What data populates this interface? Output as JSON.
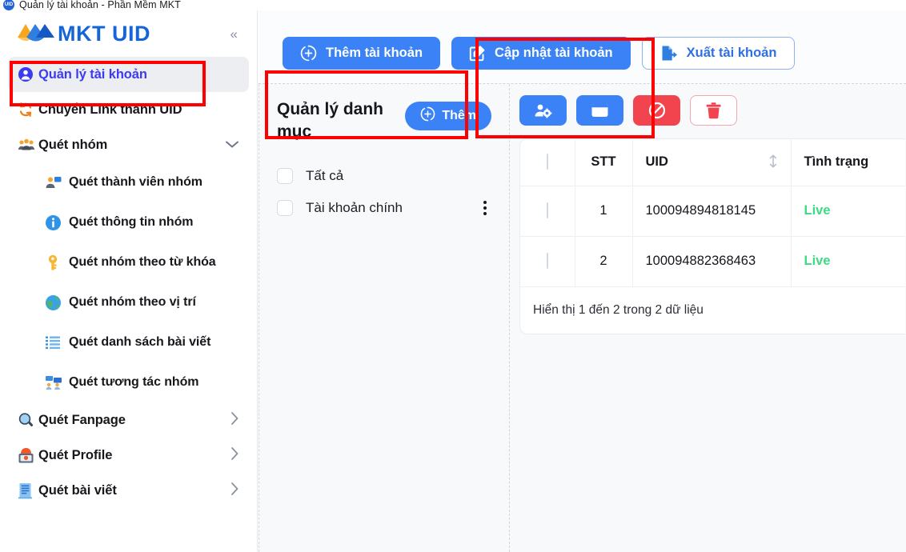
{
  "window": {
    "title": "Quản lý tài khoản - Phần Mềm MKT",
    "icon": "app-uid-icon",
    "icon_text": "UID"
  },
  "sidebar": {
    "logo_text": "MKT UID",
    "logo_icon": "mkt-logo-icon",
    "collapse_icon": "chevron-double-left-icon",
    "items": [
      {
        "label": "Quản lý tài khoản",
        "icon": "user-circle-icon",
        "active": true,
        "expandable": false
      },
      {
        "label": "Chuyển Link thành UID",
        "icon": "refresh-circular-icon",
        "active": false,
        "expandable": false
      },
      {
        "label": "Quét nhóm",
        "icon": "group-people-icon",
        "active": false,
        "expandable": true,
        "chevron": "chevron-down-icon"
      }
    ],
    "sub_items": [
      {
        "label": "Quét thành viên nhóm",
        "icon": "person-chat-icon"
      },
      {
        "label": "Quét thông tin nhóm",
        "icon": "info-circle-icon"
      },
      {
        "label": "Quét nhóm theo từ khóa",
        "icon": "key-icon"
      },
      {
        "label": "Quét nhóm theo vị trí",
        "icon": "globe-icon"
      },
      {
        "label": "Quét danh sách bài viết",
        "icon": "list-lines-icon"
      },
      {
        "label": "Quét tương tác nhóm",
        "icon": "group-interaction-icon"
      }
    ],
    "bottom_items": [
      {
        "label": "Quét Fanpage",
        "icon": "magnifier-icon",
        "chevron": "chevron-right-icon"
      },
      {
        "label": "Quét Profile",
        "icon": "profile-card-icon",
        "chevron": "chevron-right-icon"
      },
      {
        "label": "Quét bài viết",
        "icon": "document-lines-icon",
        "chevron": "chevron-right-icon"
      }
    ]
  },
  "toolbar": {
    "add_account": {
      "label": "Thêm tài khoản",
      "icon": "plus-circle-dashed-icon"
    },
    "update_account": {
      "label": "Cập nhật tài khoản",
      "icon": "edit-square-icon"
    },
    "export_account": {
      "label": "Xuất tài khoản",
      "icon": "file-export-icon"
    }
  },
  "category_panel": {
    "title": "Quản lý danh mục",
    "add_button": {
      "label": "Thêm",
      "icon": "plus-circle-dashed-icon"
    },
    "items": [
      {
        "label": "Tất cả",
        "checked": false,
        "has_menu": false
      },
      {
        "label": "Tài khoản chính",
        "checked": false,
        "has_menu": true,
        "menu_icon": "kebab-menu-icon"
      }
    ]
  },
  "table_toolbar": [
    {
      "name": "manage-account-button",
      "icon": "user-gear-icon",
      "style": "blue"
    },
    {
      "name": "folder-button",
      "icon": "folder-icon",
      "style": "blue"
    },
    {
      "name": "block-button",
      "icon": "block-slash-icon",
      "style": "red"
    },
    {
      "name": "delete-button",
      "icon": "trash-icon",
      "style": "ghost"
    }
  ],
  "table": {
    "select_all_checked": false,
    "columns": [
      {
        "key": "checkbox",
        "label": ""
      },
      {
        "key": "stt",
        "label": "STT"
      },
      {
        "key": "uid",
        "label": "UID",
        "sortable": true,
        "sort_icon": "sort-updown-icon"
      },
      {
        "key": "status",
        "label": "Tình trạng"
      }
    ],
    "rows": [
      {
        "checked": false,
        "stt": "1",
        "uid": "100094894818145",
        "status": "Live"
      },
      {
        "checked": false,
        "stt": "2",
        "uid": "100094882368463",
        "status": "Live"
      }
    ],
    "footer": "Hiển thị 1 đến 2 trong 2 dữ liệu"
  },
  "colors": {
    "primary_blue": "#3b82f6",
    "link_blue": "#2f6fe4",
    "active_nav_text": "#3b3bf0",
    "status_live": "#3ddc84",
    "danger_red": "#f2444e",
    "annotation_red": "#ff0000",
    "logo_blue": "#1565d8",
    "logo_orange": "#f7a82e"
  },
  "annotations": [
    {
      "name": "annotation-box-sidebar-account",
      "target": "Quản lý tài khoản"
    },
    {
      "name": "annotation-box-add-account",
      "target": "Thêm tài khoản"
    },
    {
      "name": "annotation-box-update-account",
      "target": "Cập nhật tài khoản"
    }
  ]
}
